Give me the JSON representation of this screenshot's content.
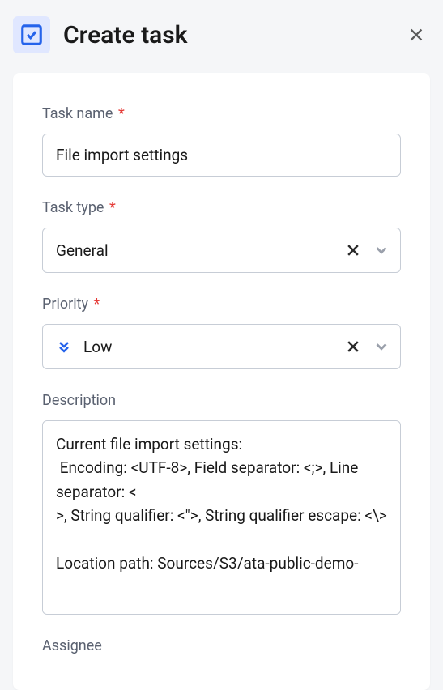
{
  "dialog": {
    "title": "Create task",
    "icon": "task-checkbox-icon"
  },
  "fields": {
    "taskName": {
      "label": "Task name",
      "required": true,
      "value": "File import settings"
    },
    "taskType": {
      "label": "Task type",
      "required": true,
      "value": "General"
    },
    "priority": {
      "label": "Priority",
      "required": true,
      "value": "Low",
      "icon": "priority-low-icon"
    },
    "description": {
      "label": "Description",
      "required": false,
      "value": "Current file import settings:\n Encoding: <UTF-8>, Field separator: <;>, Line separator: <\n>, String qualifier: <\">, String qualifier escape: <\\>\n\nLocation path: Sources/S3/ata-public-demo-"
    },
    "assignee": {
      "label": "Assignee",
      "required": false
    }
  },
  "requiredMark": "*"
}
